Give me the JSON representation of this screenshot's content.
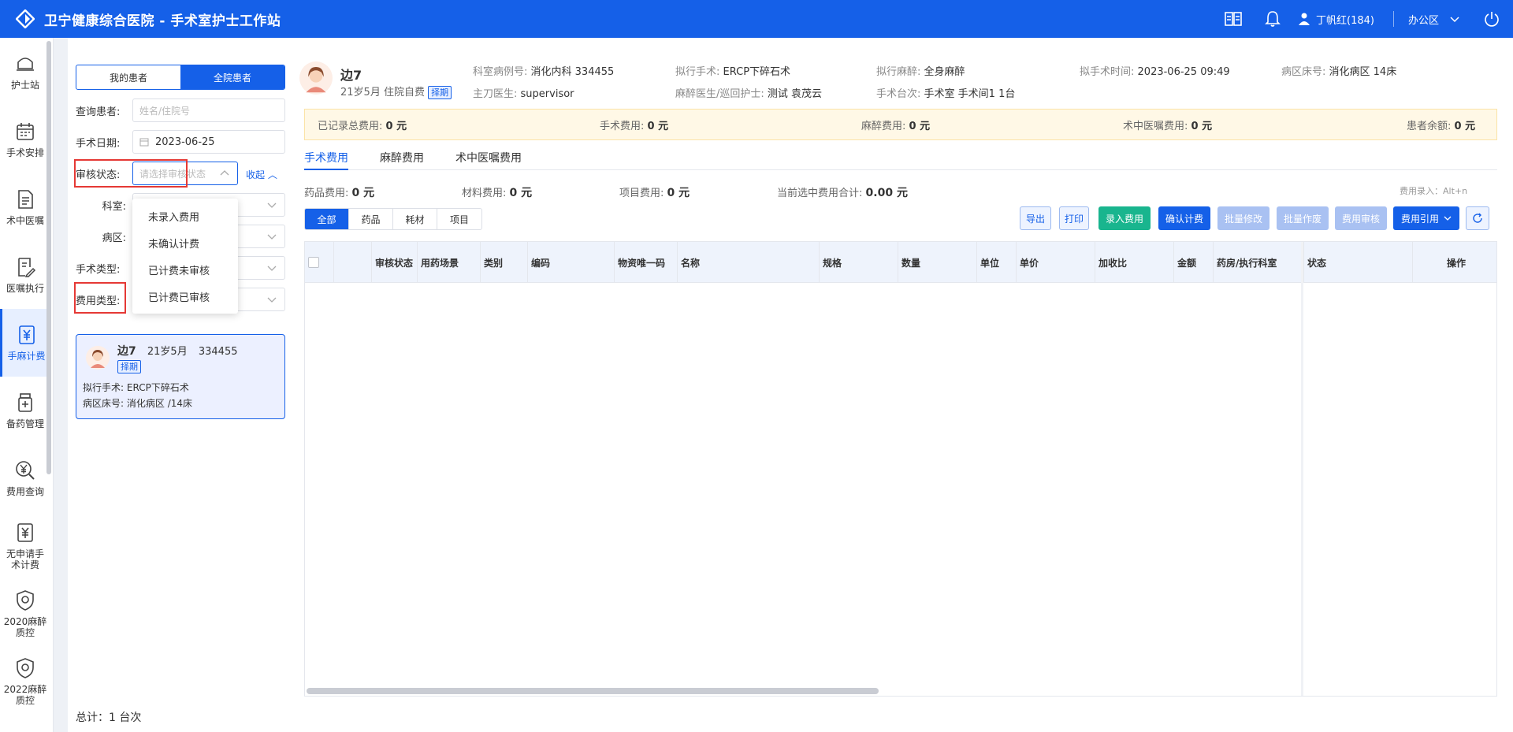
{
  "header": {
    "title": "卫宁健康综合医院 - 手术室护士工作站",
    "user": "丁帆红(184)",
    "office": "办公区"
  },
  "nav": {
    "items": [
      {
        "label": "护士站",
        "icon": "nurse-station-icon"
      },
      {
        "label": "手术安排",
        "icon": "calendar-icon"
      },
      {
        "label": "术中医嘱",
        "icon": "order-doc-icon"
      },
      {
        "label": "医嘱执行",
        "icon": "edit-doc-icon"
      },
      {
        "label": "手麻计费",
        "icon": "yuan-doc-icon"
      },
      {
        "label": "备药管理",
        "icon": "medicine-icon"
      },
      {
        "label": "费用查询",
        "icon": "yuan-search-icon"
      },
      {
        "label": "无申请手术计费",
        "icon": "yuan-doc-icon"
      },
      {
        "label": "2020麻醉质控",
        "icon": "shield-icon"
      },
      {
        "label": "2022麻醉质控",
        "icon": "shield-icon"
      }
    ]
  },
  "panel": {
    "tabs": [
      "我的患者",
      "全院患者"
    ],
    "query_label": "查询患者:",
    "query_placeholder": "姓名/住院号",
    "date_label": "手术日期:",
    "date_value": "2023-06-25",
    "audit_label": "审核状态:",
    "audit_placeholder": "请选择审核状态",
    "collapse": "收起",
    "dept_label": "科室:",
    "ward_label": "病区:",
    "optype_label": "手术类型:",
    "feetype_label": "费用类型:",
    "audit_options": [
      "未录入费用",
      "未确认计费",
      "已计费未审核",
      "已计费已审核"
    ],
    "card": {
      "name": "边7",
      "age": "21岁5月",
      "id": "334455",
      "badge": "择期",
      "op_label": "拟行手术:",
      "op": "ERCP下碎石术",
      "bed_label": "病区床号:",
      "bed": "消化病区 /14床"
    },
    "total": "总计：1 台次"
  },
  "patient": {
    "name": "边7",
    "sub": "21岁5月 住院自费",
    "badge": "择期",
    "fields": [
      {
        "k": "科室病例号:",
        "v": "消化内科 334455"
      },
      {
        "k": "拟行手术:",
        "v": "ERCP下碎石术"
      },
      {
        "k": "拟行麻醉:",
        "v": "全身麻醉"
      },
      {
        "k": "拟手术时间:",
        "v": "2023-06-25 09:49"
      },
      {
        "k": "病区床号:",
        "v": "消化病区 14床"
      },
      {
        "k": "主刀医生:",
        "v": "supervisor"
      },
      {
        "k": "麻醉医生/巡回护士:",
        "v": "测试 袁茂云"
      },
      {
        "k": "手术台次:",
        "v": "手术室 手术间1 1台"
      }
    ]
  },
  "feebar": [
    {
      "k": "已记录总费用:",
      "v": "0 元"
    },
    {
      "k": "手术费用:",
      "v": "0 元"
    },
    {
      "k": "麻醉费用:",
      "v": "0 元"
    },
    {
      "k": "术中医嘱费用:",
      "v": "0 元"
    },
    {
      "k": "患者余额:",
      "v": "0 元"
    }
  ],
  "tabs": [
    "手术费用",
    "麻醉费用",
    "术中医嘱费用"
  ],
  "sums": [
    {
      "k": "药品费用:",
      "v": "0 元"
    },
    {
      "k": "材料费用:",
      "v": "0 元"
    },
    {
      "k": "项目费用:",
      "v": "0 元"
    },
    {
      "k": "当前选中费用合计:",
      "v": "0.00 元"
    }
  ],
  "hint": "费用录入：Alt+n",
  "filters": [
    "全部",
    "药品",
    "耗材",
    "项目"
  ],
  "buttons": [
    "导出",
    "打印",
    "录入费用",
    "确认计费",
    "批量修改",
    "批量作废",
    "费用审核",
    "费用引用"
  ],
  "columns": [
    "审核状态",
    "用药场景",
    "类别",
    "编码",
    "物资唯一码",
    "名称",
    "规格",
    "数量",
    "单位",
    "单价",
    "加收比",
    "金额",
    "药房/执行科室",
    "状态",
    "操作"
  ],
  "colors": {
    "primary": "#1560e8",
    "green": "#19b58e",
    "highlight": "#e53935"
  }
}
